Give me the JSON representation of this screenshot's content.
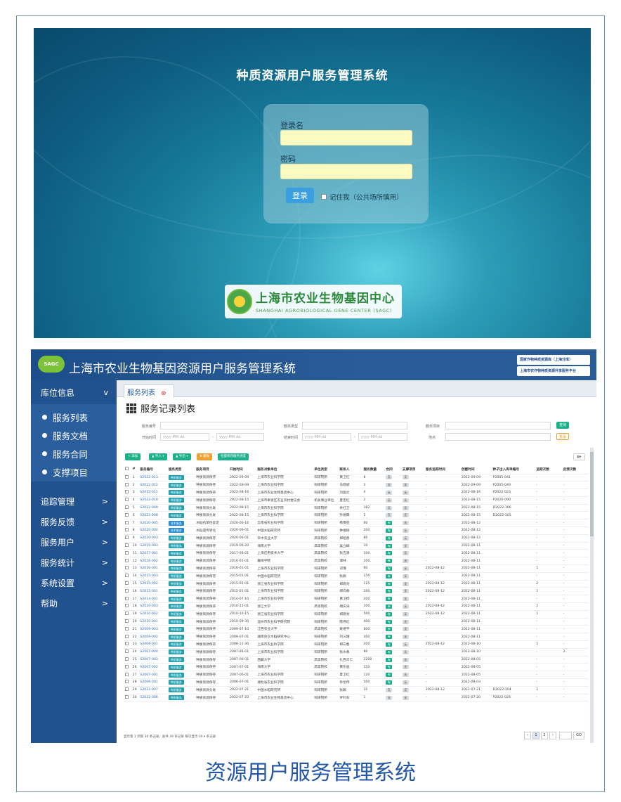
{
  "login": {
    "title": "种质资源用户服务管理系统",
    "username_label": "登录名",
    "password_label": "密码",
    "login_button": "登录",
    "remember_label": "记住我（公共场所慎用）",
    "logo_cn": "上海市农业生物基因中心",
    "logo_en": "SHANGHAI AGROBIOLOGICAL GENE CENTER (SAGC)"
  },
  "app": {
    "badge": "SAGC",
    "title": "上海市农业生物基因资源用户服务管理系统",
    "right_link_1": "国家作物种质资源库（上海分库）",
    "right_link_2": "上海市农作物种质资源共享服务平台",
    "sidebar": {
      "open_group": "库位信息",
      "open_caret": "v",
      "sub": [
        "服务列表",
        "服务文档",
        "服务合同",
        "支撑项目"
      ],
      "groups": [
        "追踪管理",
        "服务反馈",
        "服务用户",
        "服务统计",
        "系统设置",
        "帮助"
      ],
      "caret": ">"
    },
    "tab_label": "服务列表",
    "tab_close": "⊗",
    "page_title": "服务记录列表",
    "filters": {
      "service_no": "服务编号",
      "service_type": "服务类型",
      "service_item": "服务项目",
      "start_time": "开始时间",
      "end_time": "结束时间",
      "location": "地点",
      "date_ph": "yyyy-MM-dd",
      "dash": "-",
      "search_btn": "查询",
      "reset_btn": "重置"
    },
    "toolbar": [
      "+ 添加",
      "▲ 导入 ▾",
      "▲ 导出 ▾",
      "✖ 删除",
      "批量修改服务进度"
    ],
    "columns": [
      "#",
      "服务编号",
      "服务类型",
      "服务项目",
      "开始时间",
      "服务对象单位",
      "单位类型",
      "联系人",
      "服务数量",
      "合同",
      "支撑项目",
      "服务追踪时间",
      "创建时间",
      "种子出入库单编号",
      "追踪次数",
      "反馈次数"
    ],
    "rows": [
      [
        "1",
        "S2022-013",
        "种质服务",
        "种质资源保存",
        "2022-09-09",
        "上海市农业科学院",
        "科研院所",
        "黄卫红",
        "8",
        "无",
        "无",
        "-",
        "2022-09-09",
        "P2005-041",
        "-",
        "-"
      ],
      [
        "2",
        "S2022-012",
        "种质服务",
        "种质资源保存",
        "2022-09-09",
        "上海市农业科学院",
        "科研院所",
        "马晓斌",
        "3",
        "无",
        "无",
        "-",
        "2022-09-09",
        "P2005-049",
        "-",
        "-"
      ],
      [
        "3",
        "S2022-011",
        "种质服务",
        "种质资源保存",
        "2022-08-16",
        "上海市农业生物基因中心",
        "科研院所",
        "刘国兰",
        "4",
        "无",
        "无",
        "-",
        "2022-08-16",
        "P2022-023",
        "-",
        "-"
      ],
      [
        "4",
        "S2022-010",
        "种质服务",
        "种质资源保存",
        "2022-08-15",
        "上海市奉贤区农业农村委员会",
        "机关事业单位",
        "夏忠红",
        "2",
        "无",
        "无",
        "-",
        "2022-08-15",
        "P2020-090",
        "-",
        "-"
      ],
      [
        "5",
        "S2022-009",
        "种质服务",
        "种质资源分发",
        "2022-08-15",
        "上海市农业科学院",
        "科研院所",
        "余红卫",
        "182",
        "无",
        "无",
        "-",
        "2022-08-15",
        "D2022-106",
        "-",
        "-"
      ],
      [
        "6",
        "S2022-008",
        "种质服务",
        "种质资源分发",
        "2022-08-15",
        "上海市农业科学院",
        "科研院所",
        "孙德霖",
        "5",
        "无",
        "无",
        "-",
        "2022-08-15",
        "D2022-105",
        "-",
        "-"
      ],
      [
        "7",
        "S2020-005",
        "技术服务",
        "水稻抗旱性鉴定",
        "2020-06-16",
        "云南省农业科学院",
        "科研院所",
        "杨豫亚",
        "60",
        "有",
        "无",
        "-",
        "2022-08-12",
        "",
        "-",
        "-"
      ],
      [
        "8",
        "S2020-004",
        "技术服务",
        "水稻遗传转化",
        "2020-06-01",
        "中国水稻研究所",
        "科研院所",
        "钟继锋",
        "200",
        "有",
        "无",
        "-",
        "2022-08-12",
        "",
        "-",
        "-"
      ],
      [
        "9",
        "S2020-003",
        "种质服务",
        "种质资源保存",
        "2020-06-01",
        "华中农业大学",
        "高等院校",
        "郑旭勇",
        "80",
        "有",
        "无",
        "-",
        "2022-08-12",
        "",
        "-",
        "-"
      ],
      [
        "10",
        "S2019-003",
        "种质服务",
        "种质资源保存",
        "2019-06-20",
        "海南大学",
        "高等院校",
        "吴立峰",
        "10",
        "有",
        "无",
        "-",
        "2022-08-11",
        "",
        "-",
        "-"
      ],
      [
        "11",
        "S2017-001",
        "种质服务",
        "种质资源保存",
        "2017-06-01",
        "上海应用技术大学",
        "高等院校",
        "张吉源",
        "100",
        "有",
        "无",
        "-",
        "2022-08-11",
        "",
        "-",
        "-"
      ],
      [
        "12",
        "S2016-002",
        "种质服务",
        "种质资源保存",
        "2016-01-01",
        "襄阳学院",
        "高等院校",
        "谭林",
        "100",
        "有",
        "无",
        "-",
        "2022-08-11",
        "",
        "-",
        "-"
      ],
      [
        "13",
        "S2016-001",
        "种质服务",
        "种质资源保存",
        "2016-01-01",
        "上海市农业科学院",
        "科研院所",
        "邓瑾",
        "60",
        "有",
        "无",
        "2022-08-12",
        "2022-08-11",
        "",
        "1",
        "-"
      ],
      [
        "14",
        "S2015-003",
        "种质服务",
        "种质资源保存",
        "2015-01-01",
        "中国水稻研究所",
        "科研院所",
        "张颖",
        "156",
        "有",
        "无",
        "-",
        "2022-08-11",
        "",
        "-",
        "-"
      ],
      [
        "15",
        "S2015-002",
        "种质服务",
        "种质资源保存",
        "2015-01-01",
        "浙江省农业科学院",
        "科研院所",
        "郑晓龙",
        "115",
        "有",
        "无",
        "2022-08-12",
        "2022-08-11",
        "",
        "2",
        "-"
      ],
      [
        "16",
        "S2015-001",
        "种质服务",
        "种质资源保存",
        "2015-01-01",
        "上海市农业科学院",
        "科研院所",
        "郑向春",
        "200",
        "有",
        "无",
        "2022-08-12",
        "2022-08-11",
        "",
        "1",
        "-"
      ],
      [
        "17",
        "S2014-001",
        "种质服务",
        "种质资源保存",
        "2014-07-10",
        "上海市农业科学院",
        "科研院所",
        "黄卫桦",
        "200",
        "有",
        "无",
        "-",
        "2022-08-11",
        "",
        "-",
        "-"
      ],
      [
        "18",
        "S2010-003",
        "种质服务",
        "种质资源保存",
        "2010-11-01",
        "浙江大学",
        "高等院校",
        "胡庆涛",
        "100",
        "有",
        "无",
        "2022-08-12",
        "2022-08-11",
        "",
        "1",
        "-"
      ],
      [
        "19",
        "S2010-002",
        "种质服务",
        "种质资源保存",
        "2010-10-15",
        "浙江省农业科学院",
        "科研院所",
        "郑晓龙",
        "500",
        "有",
        "无",
        "2022-08-12",
        "2022-08-11",
        "",
        "1",
        "-"
      ],
      [
        "20",
        "S2010-001",
        "种质服务",
        "种质资源保存",
        "2010-09-30",
        "温州市农业科学研究院",
        "科研院所",
        "陈伟红",
        "400",
        "有",
        "无",
        "-",
        "2022-08-11",
        "",
        "-",
        "-"
      ],
      [
        "21",
        "S2009-003",
        "种质服务",
        "种质资源保存",
        "2009-07-10",
        "江西农业大学",
        "高等院校",
        "姚继平",
        "600",
        "有",
        "无",
        "-",
        "2022-08-11",
        "",
        "-",
        "-"
      ],
      [
        "22",
        "S2009-002",
        "种质服务",
        "种质资源保存",
        "2009-07-01",
        "湖南杂交水稻研究中心",
        "科研院所",
        "刘三珺",
        "300",
        "有",
        "无",
        "-",
        "2022-08-11",
        "",
        "-",
        "-"
      ],
      [
        "23",
        "S2008-001",
        "种质服务",
        "种质资源保存",
        "2008-11-30",
        "上海市农业科学院",
        "科研院所",
        "郑向春",
        "200",
        "有",
        "无",
        "2022-08-12",
        "2022-08-10",
        "",
        "1",
        "-"
      ],
      [
        "24",
        "S2007-004",
        "种质服务",
        "种质资源保存",
        "2007-06-01",
        "上海市农业科学院",
        "科研院所",
        "张水春",
        "80",
        "有",
        "无",
        "-",
        "2022-08-10",
        "",
        "-",
        "2"
      ],
      [
        "25",
        "S2007-003",
        "种质服务",
        "种质资源保存",
        "2007-06-01",
        "西藏大学",
        "高等院校",
        "扎西次仁",
        "2200",
        "有",
        "无",
        "-",
        "2022-08-05",
        "",
        "-",
        "-"
      ],
      [
        "26",
        "S2007-002",
        "种质服务",
        "种质资源保存",
        "2007-07-01",
        "海南大学",
        "高等院校",
        "黄东益",
        "150",
        "有",
        "无",
        "-",
        "2022-08-05",
        "",
        "-",
        "-"
      ],
      [
        "27",
        "S2007-001",
        "种质服务",
        "种质资源保存",
        "2007-06-01",
        "上海市农业科学院",
        "科研院所",
        "夏卫红",
        "120",
        "有",
        "无",
        "-",
        "2022-08-05",
        "",
        "-",
        "-"
      ],
      [
        "28",
        "S2006-001",
        "种质服务",
        "种质资源保存",
        "2006-07-01",
        "湖北省农业科学院",
        "科研院所",
        "孙伦伟",
        "500",
        "有",
        "无",
        "-",
        "2022-08-03",
        "",
        "-",
        "-"
      ],
      [
        "29",
        "S2022-007",
        "种质服务",
        "种质资源分发",
        "2022-07-21",
        "中国水稻研究所",
        "科研院所",
        "张颖",
        "10",
        "无",
        "无",
        "2022-08-12",
        "2022-07-21",
        "D2022-104",
        "1",
        "-"
      ],
      [
        "30",
        "S2022-006",
        "种质服务",
        "种质资源保存",
        "2022-07-20",
        "上海市农业生物基因中心",
        "科研院所",
        "罗利军",
        "1",
        "无",
        "无",
        "-",
        "2022-07-20",
        "P2022-024",
        "-",
        "-"
      ]
    ],
    "footer": "显示第 1 到第 30 条记录，总共 39 条记录  每页显示  30 ▾  条记录",
    "pager": [
      "‹",
      "1",
      "2",
      "›",
      "GO"
    ]
  },
  "caption": "资源用户服务管理系统"
}
